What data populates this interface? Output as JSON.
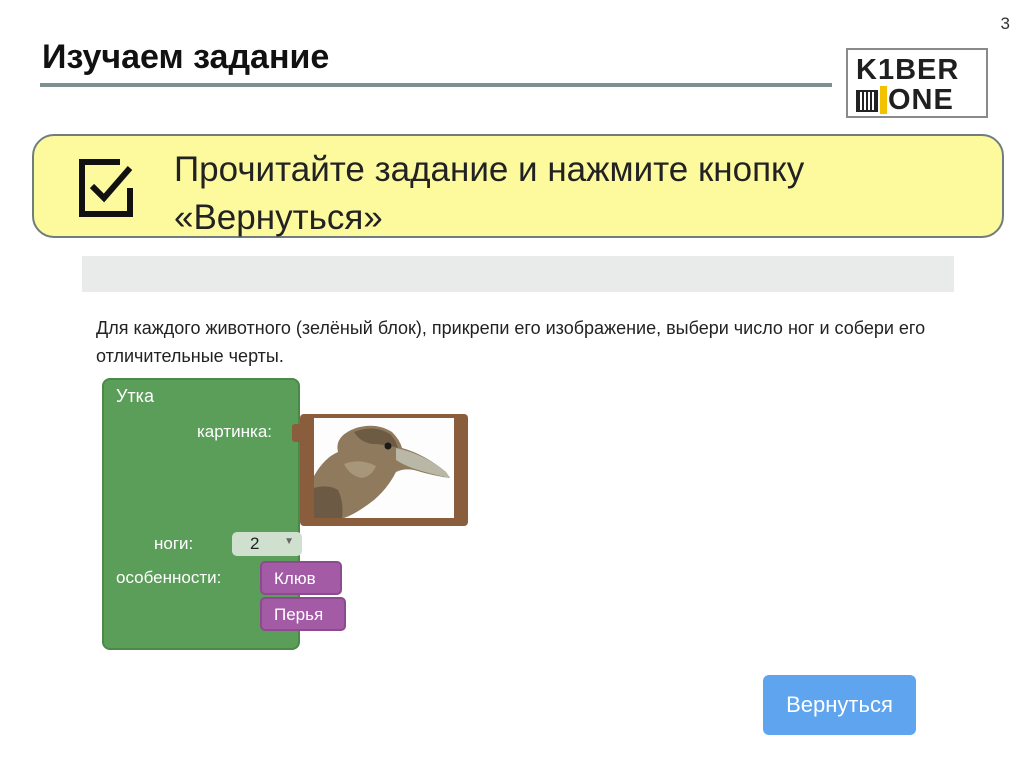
{
  "slide": {
    "number": "3",
    "title": "Изучаем задание"
  },
  "logo": {
    "line1": "K1BER",
    "line2": "ONE"
  },
  "instruction": {
    "icon": "checkbox-check-icon",
    "text_line1": "Прочитайте задание и нажмите кнопку",
    "text_line2": "«Вернуться»"
  },
  "task": {
    "description": "Для каждого животного (зелёный блок), прикрепи его изображение, выбери число ног и собери его отличительные черты.",
    "block": {
      "animal": "Утка",
      "picture_label": "картинка:",
      "legs_label": "ноги:",
      "legs_value": "2",
      "features_label": "особенности:",
      "features": [
        "Клюв",
        "Перья"
      ]
    },
    "return_button": "Вернуться"
  },
  "colors": {
    "instruction_bg": "#fdfa9e",
    "block_green": "#5b9e5a",
    "feature_purple": "#a35ba6",
    "picture_brown": "#8a5d3c",
    "button_blue": "#5ea4ee"
  }
}
